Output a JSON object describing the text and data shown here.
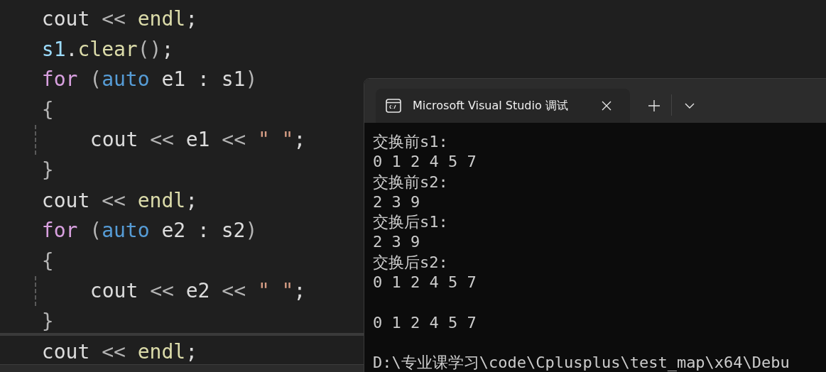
{
  "editor": {
    "lines": [
      {
        "tokens": [
          {
            "kind": "plain",
            "text": "cout "
          },
          {
            "kind": "operator",
            "text": "<<"
          },
          {
            "kind": "function",
            "text": " endl"
          },
          {
            "kind": "plain",
            "text": ";"
          }
        ]
      },
      {
        "tokens": [
          {
            "kind": "variable",
            "text": "s1"
          },
          {
            "kind": "plain",
            "text": "."
          },
          {
            "kind": "function",
            "text": "clear"
          },
          {
            "kind": "operator",
            "text": "()"
          },
          {
            "kind": "plain",
            "text": ";"
          }
        ]
      },
      {
        "tokens": [
          {
            "kind": "control",
            "text": "for"
          },
          {
            "kind": "operator",
            "text": " ("
          },
          {
            "kind": "keyword",
            "text": "auto"
          },
          {
            "kind": "plain",
            "text": " e1 : s1"
          },
          {
            "kind": "operator",
            "text": ")"
          }
        ]
      },
      {
        "tokens": [
          {
            "kind": "operator",
            "text": "{"
          }
        ],
        "children": [
          {
            "tokens": [
              {
                "kind": "plain",
                "text": "cout "
              },
              {
                "kind": "operator",
                "text": "<<"
              },
              {
                "kind": "plain",
                "text": " e1 "
              },
              {
                "kind": "operator",
                "text": "<<"
              },
              {
                "kind": "string",
                "text": " \" \""
              },
              {
                "kind": "plain",
                "text": ";"
              }
            ]
          }
        ]
      },
      {
        "tokens": [
          {
            "kind": "operator",
            "text": "}"
          }
        ]
      },
      {
        "tokens": [
          {
            "kind": "plain",
            "text": "cout "
          },
          {
            "kind": "operator",
            "text": "<<"
          },
          {
            "kind": "function",
            "text": " endl"
          },
          {
            "kind": "plain",
            "text": ";"
          }
        ]
      },
      {
        "tokens": [
          {
            "kind": "control",
            "text": "for"
          },
          {
            "kind": "operator",
            "text": " ("
          },
          {
            "kind": "keyword",
            "text": "auto"
          },
          {
            "kind": "plain",
            "text": " e2 : s2"
          },
          {
            "kind": "operator",
            "text": ")"
          }
        ]
      },
      {
        "tokens": [
          {
            "kind": "operator",
            "text": "{"
          }
        ],
        "children": [
          {
            "tokens": [
              {
                "kind": "plain",
                "text": "cout "
              },
              {
                "kind": "operator",
                "text": "<<"
              },
              {
                "kind": "plain",
                "text": " e2 "
              },
              {
                "kind": "operator",
                "text": "<<"
              },
              {
                "kind": "string",
                "text": " \" \""
              },
              {
                "kind": "plain",
                "text": ";"
              }
            ]
          }
        ]
      },
      {
        "tokens": [
          {
            "kind": "operator",
            "text": "}"
          }
        ]
      },
      {
        "tokens": [
          {
            "kind": "plain",
            "text": "cout "
          },
          {
            "kind": "operator",
            "text": "<<"
          },
          {
            "kind": "function",
            "text": " endl"
          },
          {
            "kind": "plain",
            "text": ";"
          }
        ]
      }
    ]
  },
  "terminal": {
    "tab": {
      "title": "Microsoft Visual Studio 调试"
    },
    "output": [
      {
        "lines": [
          "交换前s1:",
          "0 1 2 4 5 7",
          "交换前s2:",
          "2 3 9",
          "交换后s1:",
          "2 3 9",
          "交换后s2:",
          "0 1 2 4 5 7"
        ]
      },
      {
        "lines": [
          "0 1 2 4 5 7"
        ]
      },
      {
        "lines": [
          "D:\\专业课学习\\code\\Cplusplus\\test_map\\x64\\Debu"
        ]
      }
    ]
  }
}
